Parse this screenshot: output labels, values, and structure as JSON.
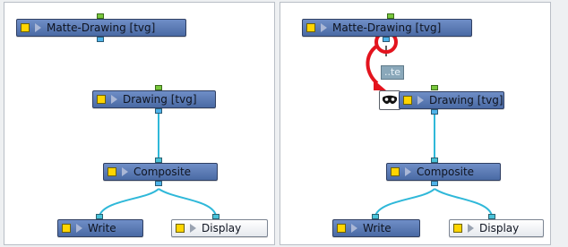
{
  "colors": {
    "wire": "#2fb8d9",
    "highlight_red": "#e3141e",
    "node_blue": "#5b7fbf",
    "enable_yellow": "#ffd500"
  },
  "left_panel": {
    "nodes": {
      "matte_drawing": "Matte-Drawing  [tvg]",
      "drawing": "Drawing  [tvg]",
      "composite": "Composite",
      "write": "Write",
      "display": "Display"
    }
  },
  "right_panel": {
    "nodes": {
      "matte_drawing": "Matte-Drawing  [tvg]",
      "drawing": "Drawing  [tvg]",
      "composite": "Composite",
      "write": "Write",
      "display": "Display"
    },
    "callout_text": "..te",
    "icons": {
      "mask_node_icon": "mask-icon",
      "highlight": "circle-highlight",
      "arrow": "curved-arrow"
    }
  }
}
